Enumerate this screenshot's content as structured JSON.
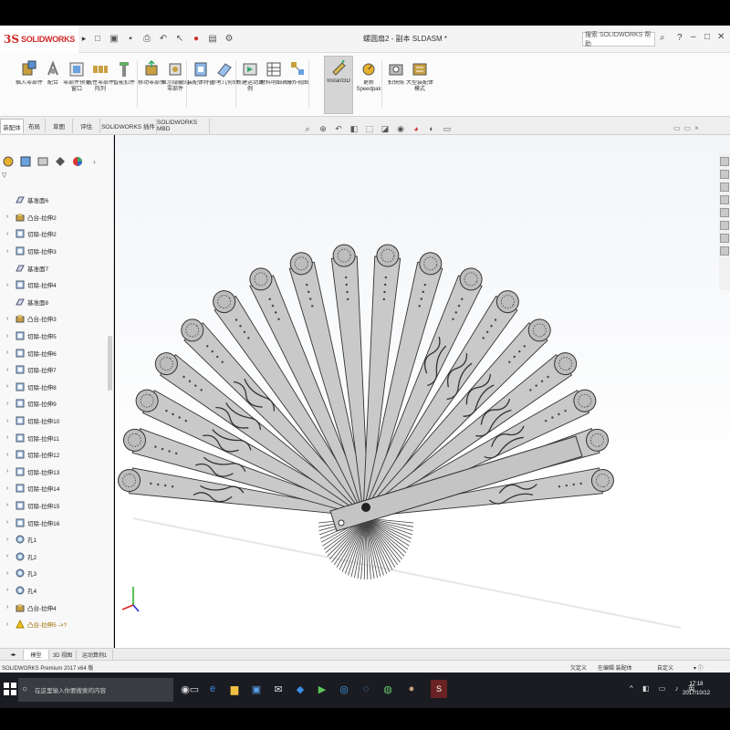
{
  "app": {
    "logo_text": "SOLIDWORKS",
    "document_title": "螺圆扇2 - 副本 SLDASM *"
  },
  "search": {
    "placeholder": "搜索 SOLIDWORKS 帮助"
  },
  "command_manager": {
    "items": [
      {
        "label": "插入零部件",
        "icon": "insert-component-icon"
      },
      {
        "label": "配合",
        "icon": "mate-icon"
      },
      {
        "label": "零部件预览窗口",
        "icon": "preview-icon"
      },
      {
        "label": "线性零部件阵列",
        "icon": "linear-pattern-icon"
      },
      {
        "label": "智能扣件",
        "icon": "smart-fastener-icon"
      },
      {
        "label": "移动零部件",
        "icon": "move-component-icon"
      },
      {
        "label": "显示隐藏的零部件",
        "icon": "show-hidden-icon"
      },
      {
        "label": "装配体特征",
        "icon": "assembly-feature-icon"
      },
      {
        "label": "参考几何体",
        "icon": "reference-geometry-icon"
      },
      {
        "label": "新建运动算例",
        "icon": "motion-study-icon"
      },
      {
        "label": "材料明细表",
        "icon": "bom-icon"
      },
      {
        "label": "爆炸视图",
        "icon": "explode-icon"
      },
      {
        "label": "Instant3D",
        "icon": "instant3d-icon"
      },
      {
        "label": "更新 Speedpak",
        "icon": "speedpak-icon"
      },
      {
        "label": "拍快照",
        "icon": "snapshot-icon"
      },
      {
        "label": "大型装配体模式",
        "icon": "large-assembly-icon"
      }
    ]
  },
  "tabs": [
    "装配体",
    "布局",
    "草图",
    "评估",
    "SOLIDWORKS 插件",
    "SOLIDWORKS MBD"
  ],
  "feature_tree": {
    "items": [
      {
        "label": "基准面6",
        "type": "plane"
      },
      {
        "label": "凸台-拉伸2",
        "type": "extrude"
      },
      {
        "label": "切除-拉伸2",
        "type": "cut"
      },
      {
        "label": "切除-拉伸3",
        "type": "cut"
      },
      {
        "label": "基准面7",
        "type": "plane"
      },
      {
        "label": "切除-拉伸4",
        "type": "cut"
      },
      {
        "label": "基准面8",
        "type": "plane"
      },
      {
        "label": "凸台-拉伸3",
        "type": "extrude"
      },
      {
        "label": "切除-拉伸5",
        "type": "cut"
      },
      {
        "label": "切除-拉伸6",
        "type": "cut"
      },
      {
        "label": "切除-拉伸7",
        "type": "cut"
      },
      {
        "label": "切除-拉伸8",
        "type": "cut"
      },
      {
        "label": "切除-拉伸9",
        "type": "cut"
      },
      {
        "label": "切除-拉伸10",
        "type": "cut"
      },
      {
        "label": "切除-拉伸11",
        "type": "cut"
      },
      {
        "label": "切除-拉伸12",
        "type": "cut"
      },
      {
        "label": "切除-拉伸13",
        "type": "cut"
      },
      {
        "label": "切除-拉伸14",
        "type": "cut"
      },
      {
        "label": "切除-拉伸15",
        "type": "cut"
      },
      {
        "label": "切除-拉伸16",
        "type": "cut"
      },
      {
        "label": "孔1",
        "type": "hole"
      },
      {
        "label": "孔2",
        "type": "hole"
      },
      {
        "label": "孔3",
        "type": "hole"
      },
      {
        "label": "孔4",
        "type": "hole"
      },
      {
        "label": "凸台-拉伸4",
        "type": "extrude"
      },
      {
        "label": "凸台-拉伸5 ->?",
        "type": "warning"
      }
    ]
  },
  "model_tabs": [
    "模型",
    "3D 视图",
    "运动算例1"
  ],
  "status": {
    "product": "SOLIDWORKS Premium 2017 x64 版",
    "left_status": "欠定义",
    "editing": "在编辑 装配体",
    "custom": "自定义"
  },
  "taskbar": {
    "search_placeholder": "在这里输入你要搜索的内容",
    "time": "17:18",
    "date": "2017/10/12"
  },
  "colors": {
    "brand_red": "#d22b27",
    "fan_fill": "#c9c9c9",
    "fan_stroke": "#333333",
    "taskbar_bg": "#1a1c22"
  }
}
